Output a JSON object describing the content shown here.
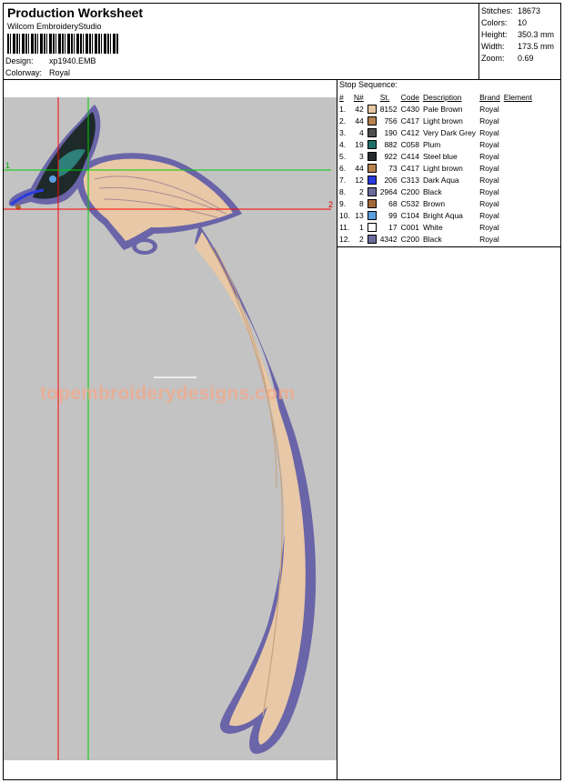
{
  "header": {
    "title": "Production Worksheet",
    "software": "Wilcom EmbroideryStudio",
    "design_label": "Design:",
    "design_value": "xp1940.EMB",
    "colorway_label": "Colorway:",
    "colorway_value": "Royal"
  },
  "stats": [
    {
      "label": "Stitches:",
      "value": "18673"
    },
    {
      "label": "Colors:",
      "value": "10"
    },
    {
      "label": "Height:",
      "value": "350.3 mm"
    },
    {
      "label": "Width:",
      "value": "173.5 mm"
    },
    {
      "label": "Zoom:",
      "value": "0.69"
    }
  ],
  "preview": {
    "watermark": "topembroiderydesigns.com",
    "marker_1": "1",
    "marker_2": "2",
    "background": "#c3c3c3"
  },
  "stop_sequence": {
    "title": "Stop Sequence:",
    "headers": {
      "idx": "#",
      "n": "N#",
      "st": "St.",
      "code": "Code",
      "desc": "Description",
      "brand": "Brand",
      "element": "Element"
    },
    "rows": [
      {
        "idx": "1.",
        "n": "42",
        "color": "#e6c7a3",
        "st": "8152",
        "code": "C430",
        "desc": "Pale Brown",
        "brand": "Royal"
      },
      {
        "idx": "2.",
        "n": "44",
        "color": "#b58250",
        "st": "756",
        "code": "C417",
        "desc": "Light brown",
        "brand": "Royal"
      },
      {
        "idx": "3.",
        "n": "4",
        "color": "#4f4f4f",
        "st": "190",
        "code": "C412",
        "desc": "Very Dark Grey",
        "brand": "Royal"
      },
      {
        "idx": "4.",
        "n": "19",
        "color": "#1f6f6a",
        "st": "882",
        "code": "C058",
        "desc": "Plum",
        "brand": "Royal"
      },
      {
        "idx": "5.",
        "n": "3",
        "color": "#262b2e",
        "st": "922",
        "code": "C414",
        "desc": "Steel blue",
        "brand": "Royal"
      },
      {
        "idx": "6.",
        "n": "44",
        "color": "#b58250",
        "st": "73",
        "code": "C417",
        "desc": "Light brown",
        "brand": "Royal"
      },
      {
        "idx": "7.",
        "n": "12",
        "color": "#2a3be0",
        "st": "206",
        "code": "C313",
        "desc": "Dark Aqua",
        "brand": "Royal"
      },
      {
        "idx": "8.",
        "n": "2",
        "color": "#6c6c9c",
        "st": "2964",
        "code": "C200",
        "desc": "Black",
        "brand": "Royal"
      },
      {
        "idx": "9.",
        "n": "8",
        "color": "#a36a3a",
        "st": "68",
        "code": "C532",
        "desc": "Brown",
        "brand": "Royal"
      },
      {
        "idx": "10.",
        "n": "13",
        "color": "#5aa0e0",
        "st": "99",
        "code": "C104",
        "desc": "Bright Aqua",
        "brand": "Royal"
      },
      {
        "idx": "11.",
        "n": "1",
        "color": "#ffffff",
        "st": "17",
        "code": "C001",
        "desc": "White",
        "brand": "Royal"
      },
      {
        "idx": "12.",
        "n": "2",
        "color": "#6c6c9c",
        "st": "4342",
        "code": "C200",
        "desc": "Black",
        "brand": "Royal"
      }
    ]
  }
}
